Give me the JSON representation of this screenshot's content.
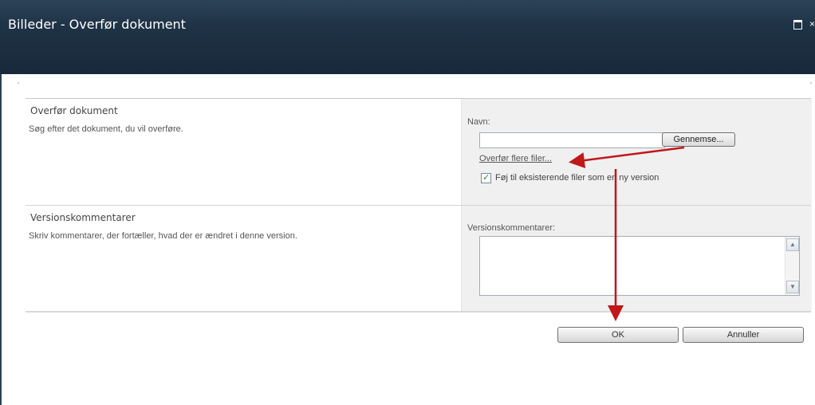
{
  "window": {
    "title": "Billeder - Overfør dokument",
    "close_glyph": "×"
  },
  "section_upload": {
    "title": "Overfør dokument",
    "description": "Søg efter det dokument, du vil overføre.",
    "name_label": "Navn:",
    "file_value": "",
    "browse_label": "Gennemse...",
    "multi_link": "Overfør flere filer...",
    "overwrite_checked": true,
    "overwrite_label": "Føj til eksisterende filer som en ny version"
  },
  "section_comments": {
    "title": "Versionskommentarer",
    "description": "Skriv kommentarer, der fortæller, hvad der er ændret i denne version.",
    "field_label": "Versionskommentarer:",
    "field_value": ""
  },
  "buttons": {
    "ok": "OK",
    "cancel": "Annuller"
  },
  "colors": {
    "titlebar": "#1f3346",
    "control_column": "#f0f0f0",
    "annotation_arrow": "#c0171b"
  },
  "icons": {
    "maximize": "maximize-icon",
    "close": "close-icon",
    "check": "checkmark-icon",
    "scroll_up": "scroll-up-icon",
    "scroll_down": "scroll-down-icon"
  }
}
